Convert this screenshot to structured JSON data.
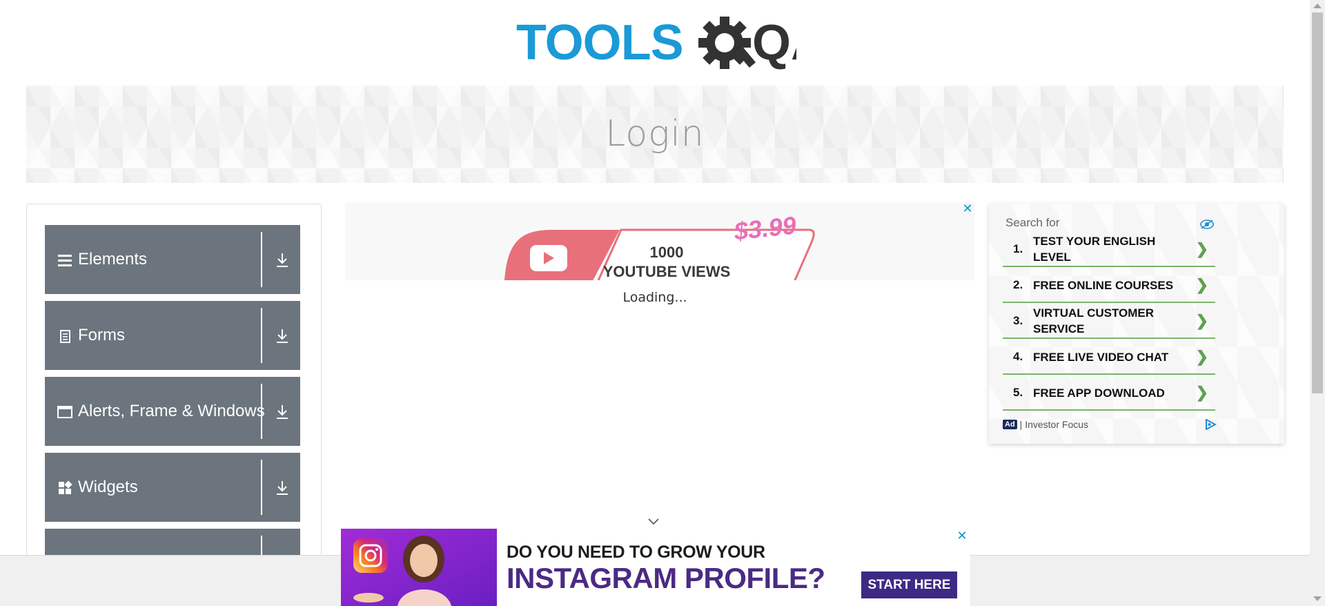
{
  "header": {
    "logo_text_left": "TOOLS",
    "logo_text_right": "QA"
  },
  "banner": {
    "title": "Login"
  },
  "sidebar": {
    "groups": [
      {
        "label": "Elements",
        "icon": "list-icon"
      },
      {
        "label": "Forms",
        "icon": "form-icon"
      },
      {
        "label": "Alerts, Frame & Windows",
        "icon": "window-icon"
      },
      {
        "label": "Widgets",
        "icon": "widgets-icon"
      },
      {
        "label": "",
        "icon": ""
      }
    ]
  },
  "ad_top": {
    "views_line1": "1000",
    "views_line2": "YOUTUBE VIEWS",
    "price": "$3.99",
    "loading": "Loading..."
  },
  "ad_right": {
    "search_for": "Search for",
    "items": [
      {
        "num": "1.",
        "text": "TEST YOUR ENGLISH LEVEL"
      },
      {
        "num": "2.",
        "text": "FREE ONLINE COURSES"
      },
      {
        "num": "3.",
        "text": "VIRTUAL CUSTOMER SERVICE"
      },
      {
        "num": "4.",
        "text": "FREE LIVE VIDEO CHAT"
      },
      {
        "num": "5.",
        "text": "FREE APP DOWNLOAD"
      }
    ],
    "badge": "Ad",
    "sponsor": "| Investor Focus"
  },
  "ad_bottom": {
    "line1": "DO YOU NEED TO GROW YOUR",
    "line2": "INSTAGRAM PROFILE?",
    "button": "START HERE"
  },
  "colors": {
    "brand_blue": "#1a9ad6",
    "brand_dark": "#333333",
    "sidebar_group": "#6c757d",
    "ad_accent": "#0099cc",
    "ad_row_border": "#7ab56b",
    "instagram_purple": "#4b2a84"
  }
}
